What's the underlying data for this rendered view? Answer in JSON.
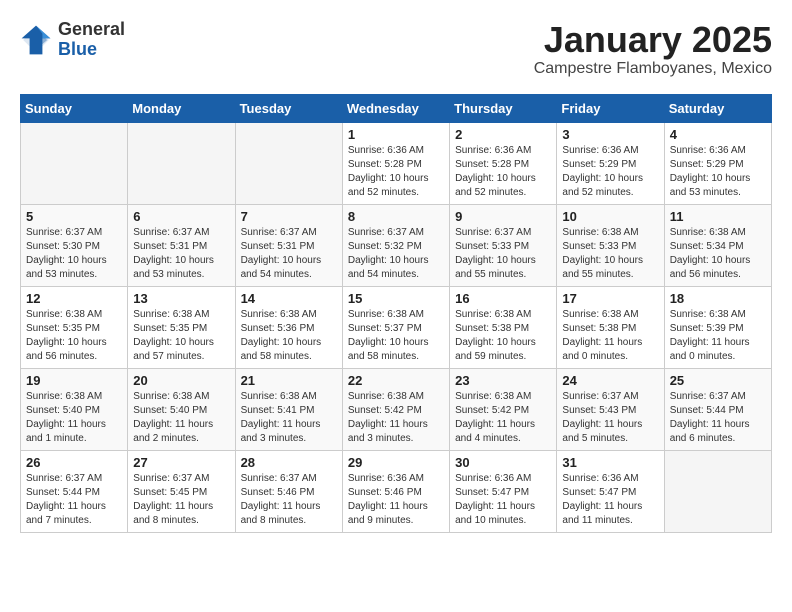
{
  "header": {
    "logo_general": "General",
    "logo_blue": "Blue",
    "month_title": "January 2025",
    "location": "Campestre Flamboyanes, Mexico"
  },
  "days_of_week": [
    "Sunday",
    "Monday",
    "Tuesday",
    "Wednesday",
    "Thursday",
    "Friday",
    "Saturday"
  ],
  "weeks": [
    [
      {
        "day": "",
        "info": ""
      },
      {
        "day": "",
        "info": ""
      },
      {
        "day": "",
        "info": ""
      },
      {
        "day": "1",
        "info": "Sunrise: 6:36 AM\nSunset: 5:28 PM\nDaylight: 10 hours\nand 52 minutes."
      },
      {
        "day": "2",
        "info": "Sunrise: 6:36 AM\nSunset: 5:28 PM\nDaylight: 10 hours\nand 52 minutes."
      },
      {
        "day": "3",
        "info": "Sunrise: 6:36 AM\nSunset: 5:29 PM\nDaylight: 10 hours\nand 52 minutes."
      },
      {
        "day": "4",
        "info": "Sunrise: 6:36 AM\nSunset: 5:29 PM\nDaylight: 10 hours\nand 53 minutes."
      }
    ],
    [
      {
        "day": "5",
        "info": "Sunrise: 6:37 AM\nSunset: 5:30 PM\nDaylight: 10 hours\nand 53 minutes."
      },
      {
        "day": "6",
        "info": "Sunrise: 6:37 AM\nSunset: 5:31 PM\nDaylight: 10 hours\nand 53 minutes."
      },
      {
        "day": "7",
        "info": "Sunrise: 6:37 AM\nSunset: 5:31 PM\nDaylight: 10 hours\nand 54 minutes."
      },
      {
        "day": "8",
        "info": "Sunrise: 6:37 AM\nSunset: 5:32 PM\nDaylight: 10 hours\nand 54 minutes."
      },
      {
        "day": "9",
        "info": "Sunrise: 6:37 AM\nSunset: 5:33 PM\nDaylight: 10 hours\nand 55 minutes."
      },
      {
        "day": "10",
        "info": "Sunrise: 6:38 AM\nSunset: 5:33 PM\nDaylight: 10 hours\nand 55 minutes."
      },
      {
        "day": "11",
        "info": "Sunrise: 6:38 AM\nSunset: 5:34 PM\nDaylight: 10 hours\nand 56 minutes."
      }
    ],
    [
      {
        "day": "12",
        "info": "Sunrise: 6:38 AM\nSunset: 5:35 PM\nDaylight: 10 hours\nand 56 minutes."
      },
      {
        "day": "13",
        "info": "Sunrise: 6:38 AM\nSunset: 5:35 PM\nDaylight: 10 hours\nand 57 minutes."
      },
      {
        "day": "14",
        "info": "Sunrise: 6:38 AM\nSunset: 5:36 PM\nDaylight: 10 hours\nand 58 minutes."
      },
      {
        "day": "15",
        "info": "Sunrise: 6:38 AM\nSunset: 5:37 PM\nDaylight: 10 hours\nand 58 minutes."
      },
      {
        "day": "16",
        "info": "Sunrise: 6:38 AM\nSunset: 5:38 PM\nDaylight: 10 hours\nand 59 minutes."
      },
      {
        "day": "17",
        "info": "Sunrise: 6:38 AM\nSunset: 5:38 PM\nDaylight: 11 hours\nand 0 minutes."
      },
      {
        "day": "18",
        "info": "Sunrise: 6:38 AM\nSunset: 5:39 PM\nDaylight: 11 hours\nand 0 minutes."
      }
    ],
    [
      {
        "day": "19",
        "info": "Sunrise: 6:38 AM\nSunset: 5:40 PM\nDaylight: 11 hours\nand 1 minute."
      },
      {
        "day": "20",
        "info": "Sunrise: 6:38 AM\nSunset: 5:40 PM\nDaylight: 11 hours\nand 2 minutes."
      },
      {
        "day": "21",
        "info": "Sunrise: 6:38 AM\nSunset: 5:41 PM\nDaylight: 11 hours\nand 3 minutes."
      },
      {
        "day": "22",
        "info": "Sunrise: 6:38 AM\nSunset: 5:42 PM\nDaylight: 11 hours\nand 3 minutes."
      },
      {
        "day": "23",
        "info": "Sunrise: 6:38 AM\nSunset: 5:42 PM\nDaylight: 11 hours\nand 4 minutes."
      },
      {
        "day": "24",
        "info": "Sunrise: 6:37 AM\nSunset: 5:43 PM\nDaylight: 11 hours\nand 5 minutes."
      },
      {
        "day": "25",
        "info": "Sunrise: 6:37 AM\nSunset: 5:44 PM\nDaylight: 11 hours\nand 6 minutes."
      }
    ],
    [
      {
        "day": "26",
        "info": "Sunrise: 6:37 AM\nSunset: 5:44 PM\nDaylight: 11 hours\nand 7 minutes."
      },
      {
        "day": "27",
        "info": "Sunrise: 6:37 AM\nSunset: 5:45 PM\nDaylight: 11 hours\nand 8 minutes."
      },
      {
        "day": "28",
        "info": "Sunrise: 6:37 AM\nSunset: 5:46 PM\nDaylight: 11 hours\nand 8 minutes."
      },
      {
        "day": "29",
        "info": "Sunrise: 6:36 AM\nSunset: 5:46 PM\nDaylight: 11 hours\nand 9 minutes."
      },
      {
        "day": "30",
        "info": "Sunrise: 6:36 AM\nSunset: 5:47 PM\nDaylight: 11 hours\nand 10 minutes."
      },
      {
        "day": "31",
        "info": "Sunrise: 6:36 AM\nSunset: 5:47 PM\nDaylight: 11 hours\nand 11 minutes."
      },
      {
        "day": "",
        "info": ""
      }
    ]
  ]
}
